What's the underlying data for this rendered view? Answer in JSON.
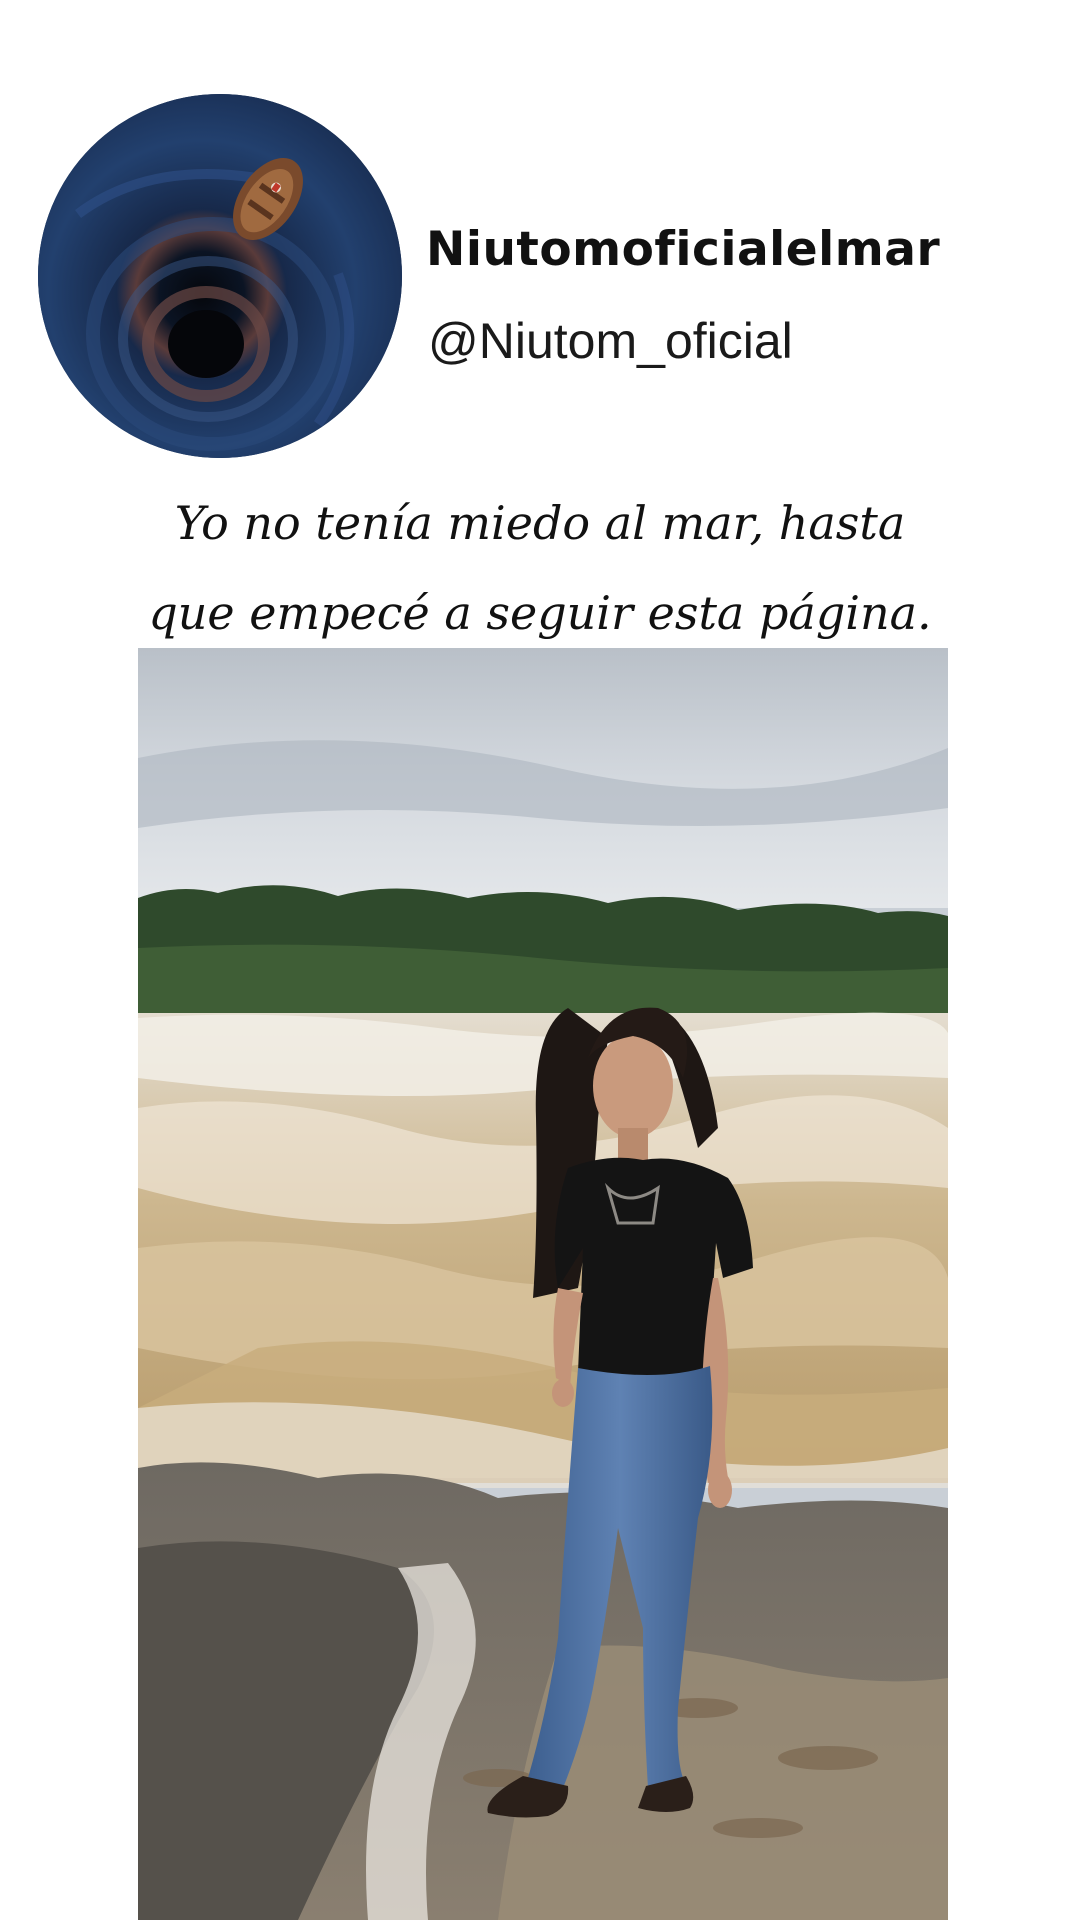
{
  "profile": {
    "display_name": "Niutomoficialelmar",
    "handle": "@Niutom_oficial",
    "avatar_icon": "boat-over-whirlpool-avatar"
  },
  "post": {
    "caption_line_1": "Yo no tenía miedo al mar, hasta",
    "caption_line_2": "que empecé a seguir esta página.",
    "photo_icon": "woman-at-waterfall-photo"
  },
  "colors": {
    "background": "#ffffff",
    "text": "#111111",
    "avatar_water": "#1d3557"
  }
}
